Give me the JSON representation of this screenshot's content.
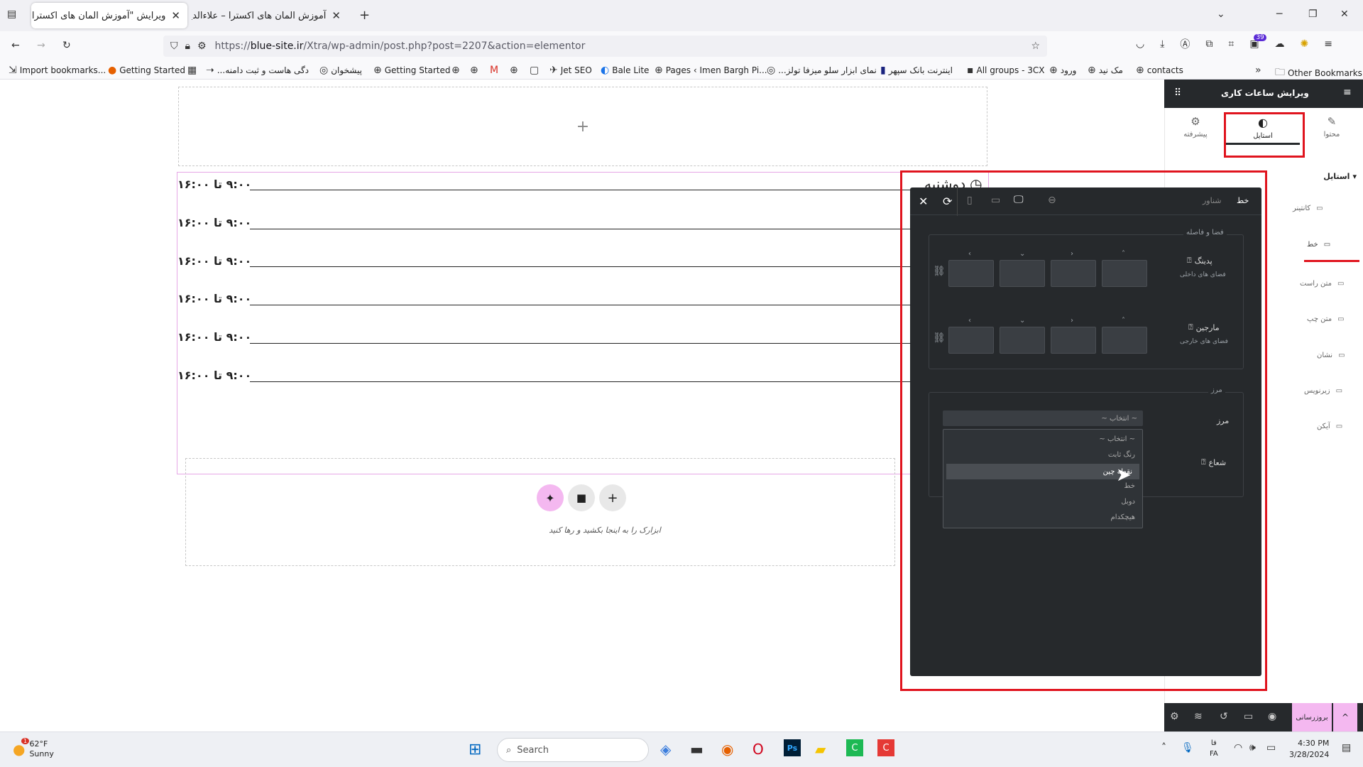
{
  "browser": {
    "tabs": [
      {
        "label": "ویرایش \"آموزش المان های اکسترا -",
        "active": true
      },
      {
        "label": "آموزش المان های اکسترا – علاءالدین",
        "active": false
      }
    ],
    "new_tab": "+",
    "url_prefix": "https://",
    "url_host": "blue-site.ir",
    "url_path": "/Xtra/wp-admin/post.php?post=2207&action=elementor",
    "extension_badge": "39"
  },
  "bookmarks": [
    "Import bookmarks...",
    "Getting Started",
    "...دگی هاست و ثبت دامنه",
    "پیشخوان",
    "Getting Started",
    "Jet SEO",
    "Bale Lite",
    "Pages ‹ Imen Bargh Pi...",
    "...نمای ابزار سلو میزفا تولز",
    "اینترنت بانک سپهر",
    "All groups - 3CX",
    "ورود",
    "مک نید",
    "contacts",
    "Other Bookmarks"
  ],
  "canvas": {
    "add_section_plus": "+",
    "day_label": "دوشنبه",
    "hours": [
      "۹:۰۰ تا ۱۶:۰۰",
      "۹:۰۰ تا ۱۶:۰۰",
      "۹:۰۰ تا ۱۶:۰۰",
      "۹:۰۰ تا ۱۶:۰۰",
      "۹:۰۰ تا ۱۶:۰۰",
      "۹:۰۰ تا ۱۶:۰۰"
    ],
    "drop_hint": "ابزارک را به اینجا بکشید و رها کنید"
  },
  "panel": {
    "title": "ویرایش ساعات کاری",
    "tabs": [
      {
        "label": "محتوا",
        "icon": "pencil-icon"
      },
      {
        "label": "استایل",
        "icon": "contrast-icon"
      },
      {
        "label": "پیشرفته",
        "icon": "gear-icon"
      }
    ],
    "section_title": "استایل",
    "items": [
      "کانتینر",
      "خط",
      "متن راست",
      "متن چپ",
      "نشان",
      "زیرنویس",
      "آیکن"
    ],
    "footer_update": "بروزرسانی"
  },
  "popover": {
    "tabs": [
      "خط",
      "شناور"
    ],
    "spacing_section": "فضا و فاصله",
    "padding_label": "پدینگ",
    "padding_desc": "فضای های داخلی",
    "margin_label": "مارجین",
    "margin_desc": "فضای های خارجی",
    "border_section": "مرز",
    "border_label": "مرز",
    "radius_label": "شعاع",
    "select_value": "~ انتخاب ~",
    "dropdown_options": [
      "~ انتخاب ~",
      "رنگ ثابت",
      "نقطه چین",
      "خط",
      "دوبل",
      "هیچکدام"
    ],
    "dropdown_highlighted": "نقطه چین"
  },
  "taskbar": {
    "weather_temp": "62°F",
    "weather_desc": "Sunny",
    "weather_badge": "1",
    "search_placeholder": "Search",
    "lang_top": "فا",
    "lang_bottom": "FA",
    "time": "4:30 PM",
    "date": "3/28/2024"
  },
  "colors": {
    "highlight_red": "#e0141e",
    "panel_dark": "#26292c",
    "ai_button_pink": "#f4b8f0",
    "element_outline": "#e6a7e6"
  }
}
